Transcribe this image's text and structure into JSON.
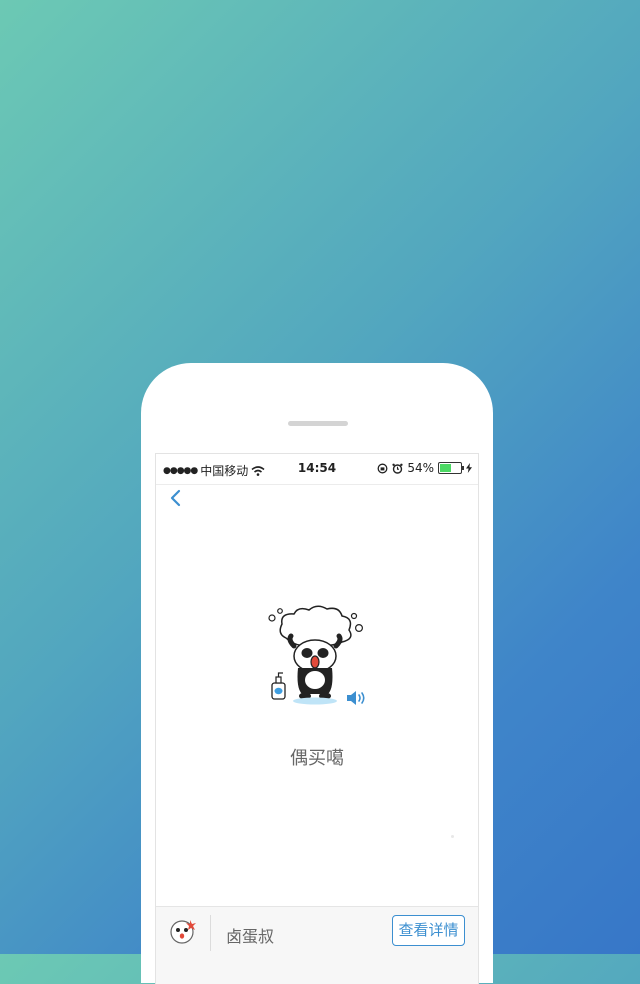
{
  "status_bar": {
    "carrier": "中国移动",
    "time": "14:54",
    "battery_percent": "54%",
    "battery_level": 0.54,
    "icons": [
      "signal-dots-icon",
      "wifi-icon",
      "orientation-lock-icon",
      "alarm-icon",
      "battery-icon",
      "charging-icon"
    ]
  },
  "nav": {
    "back_icon": "chevron-left-icon"
  },
  "content": {
    "sticker": "panda-washing-hair-sticker",
    "sound_icon": "speaker-icon",
    "caption": "偶买噶"
  },
  "bottom_bar": {
    "avatar": "sticker-author-avatar",
    "author_name": "卤蛋叔",
    "detail_button": "查看详情"
  },
  "colors": {
    "accent": "#3c8fd0",
    "background_gradient_start": "#6cc9b4",
    "background_gradient_end": "#3777c8",
    "battery_fill": "#4cd964"
  }
}
